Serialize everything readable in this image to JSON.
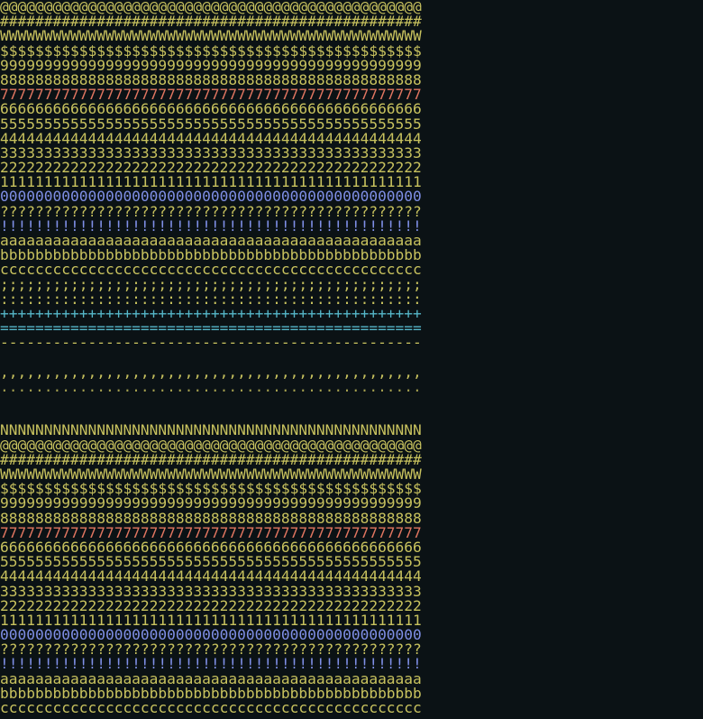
{
  "terminal": {
    "rows": [
      {
        "text": "@@@@@@@@@@@@@@@@@@@@@@@@@@@@@@@@@@@@@@@@@@@@@@@@",
        "color": "yellow"
      },
      {
        "text": "################################################",
        "color": "yellow"
      },
      {
        "text": "WWWWWWWWWWWWWWWWWWWWWWWWWWWWWWWWWWWWWWWWWWWWWWWW",
        "color": "yellow"
      },
      {
        "text": "$$$$$$$$$$$$$$$$$$$$$$$$$$$$$$$$$$$$$$$$$$$$$$$$",
        "color": "yellow"
      },
      {
        "text": "999999999999999999999999999999999999999999999999",
        "color": "yellow"
      },
      {
        "text": "888888888888888888888888888888888888888888888888",
        "color": "yellow"
      },
      {
        "text": "777777777777777777777777777777777777777777777777",
        "color": "red"
      },
      {
        "text": "666666666666666666666666666666666666666666666666",
        "color": "yellow"
      },
      {
        "text": "555555555555555555555555555555555555555555555555",
        "color": "yellow"
      },
      {
        "text": "444444444444444444444444444444444444444444444444",
        "color": "yellow"
      },
      {
        "text": "333333333333333333333333333333333333333333333333",
        "color": "yellow"
      },
      {
        "text": "222222222222222222222222222222222222222222222222",
        "color": "yellow"
      },
      {
        "text": "111111111111111111111111111111111111111111111111",
        "color": "yellow"
      },
      {
        "text": "000000000000000000000000000000000000000000000000",
        "color": "blue"
      },
      {
        "text": "????????????????????????????????????????????????",
        "color": "yellow"
      },
      {
        "text": "!!!!!!!!!!!!!!!!!!!!!!!!!!!!!!!!!!!!!!!!!!!!!!!!",
        "color": "blue"
      },
      {
        "text": "aaaaaaaaaaaaaaaaaaaaaaaaaaaaaaaaaaaaaaaaaaaaaaaa",
        "color": "yellow"
      },
      {
        "text": "bbbbbbbbbbbbbbbbbbbbbbbbbbbbbbbbbbbbbbbbbbbbbbbb",
        "color": "yellow"
      },
      {
        "text": "cccccccccccccccccccccccccccccccccccccccccccccccc",
        "color": "yellow"
      },
      {
        "text": ";;;;;;;;;;;;;;;;;;;;;;;;;;;;;;;;;;;;;;;;;;;;;;;;",
        "color": "yellow"
      },
      {
        "text": "::::::::::::::::::::::::::::::::::::::::::::::::",
        "color": "yellow"
      },
      {
        "text": "++++++++++++++++++++++++++++++++++++++++++++++++",
        "color": "cyan"
      },
      {
        "text": "================================================",
        "color": "cyan"
      },
      {
        "text": "------------------------------------------------",
        "color": "yellow"
      },
      {
        "text": "",
        "color": "yellow"
      },
      {
        "text": ",,,,,,,,,,,,,,,,,,,,,,,,,,,,,,,,,,,,,,,,,,,,,,,,",
        "color": "yellow"
      },
      {
        "text": "................................................",
        "color": "dim"
      },
      {
        "text": "",
        "color": "yellow"
      },
      {
        "text": "",
        "color": "yellow"
      },
      {
        "text": "ÑÑÑÑÑÑÑÑÑÑÑÑÑÑÑÑÑÑÑÑÑÑÑÑÑÑÑÑÑÑÑÑÑÑÑÑÑÑÑÑÑÑÑÑÑÑÑÑ",
        "color": "yellow"
      },
      {
        "text": "@@@@@@@@@@@@@@@@@@@@@@@@@@@@@@@@@@@@@@@@@@@@@@@@",
        "color": "yellow"
      },
      {
        "text": "################################################",
        "color": "yellow"
      },
      {
        "text": "WWWWWWWWWWWWWWWWWWWWWWWWWWWWWWWWWWWWWWWWWWWWWWWW",
        "color": "yellow"
      },
      {
        "text": "$$$$$$$$$$$$$$$$$$$$$$$$$$$$$$$$$$$$$$$$$$$$$$$$",
        "color": "yellow"
      },
      {
        "text": "999999999999999999999999999999999999999999999999",
        "color": "yellow"
      },
      {
        "text": "888888888888888888888888888888888888888888888888",
        "color": "yellow"
      },
      {
        "text": "777777777777777777777777777777777777777777777777",
        "color": "red"
      },
      {
        "text": "666666666666666666666666666666666666666666666666",
        "color": "yellow"
      },
      {
        "text": "555555555555555555555555555555555555555555555555",
        "color": "yellow"
      },
      {
        "text": "444444444444444444444444444444444444444444444444",
        "color": "yellow"
      },
      {
        "text": "333333333333333333333333333333333333333333333333",
        "color": "yellow"
      },
      {
        "text": "222222222222222222222222222222222222222222222222",
        "color": "yellow"
      },
      {
        "text": "111111111111111111111111111111111111111111111111",
        "color": "yellow"
      },
      {
        "text": "000000000000000000000000000000000000000000000000",
        "color": "blue"
      },
      {
        "text": "????????????????????????????????????????????????",
        "color": "yellow"
      },
      {
        "text": "!!!!!!!!!!!!!!!!!!!!!!!!!!!!!!!!!!!!!!!!!!!!!!!!",
        "color": "blue"
      },
      {
        "text": "aaaaaaaaaaaaaaaaaaaaaaaaaaaaaaaaaaaaaaaaaaaaaaaa",
        "color": "yellow"
      },
      {
        "text": "bbbbbbbbbbbbbbbbbbbbbbbbbbbbbbbbbbbbbbbbbbbbbbbb",
        "color": "yellow"
      },
      {
        "text": "cccccccccccccccccccccccccccccccccccccccccccccccc",
        "color": "yellow"
      }
    ],
    "colors": {
      "background": "#0b1215",
      "yellow": "#c8c25e",
      "red": "#e07560",
      "blue": "#7f8fe6",
      "cyan": "#56b7c9",
      "dim": "#a49f4e"
    }
  }
}
